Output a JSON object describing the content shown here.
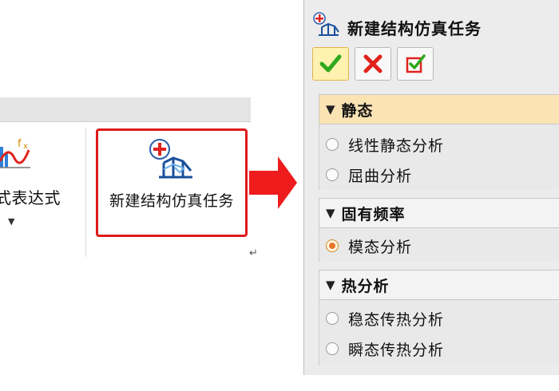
{
  "ribbon": {
    "formula_label": "式表达式",
    "task_button_label": "新建结构仿真任务",
    "paragraph_mark": "↵"
  },
  "dialog": {
    "title": "新建结构仿真任务",
    "toolbar": {
      "ok_icon": "check-icon",
      "cancel_icon": "close-icon",
      "apply_icon": "apply-check-icon"
    },
    "sections": [
      {
        "title": "静态",
        "options": [
          {
            "label": "线性静态分析",
            "checked": false
          },
          {
            "label": "屈曲分析",
            "checked": false
          }
        ]
      },
      {
        "title": "固有频率",
        "options": [
          {
            "label": "模态分析",
            "checked": true
          }
        ]
      },
      {
        "title": "热分析",
        "options": [
          {
            "label": "稳态传热分析",
            "checked": false
          },
          {
            "label": "瞬态传热分析",
            "checked": false
          }
        ]
      }
    ]
  },
  "colors": {
    "highlight": "#e01a1a",
    "active_section": "#fbe3b4",
    "ok_green": "#2fa81b",
    "cancel_red": "#e0221b",
    "radio_checked": "#e8772b"
  }
}
